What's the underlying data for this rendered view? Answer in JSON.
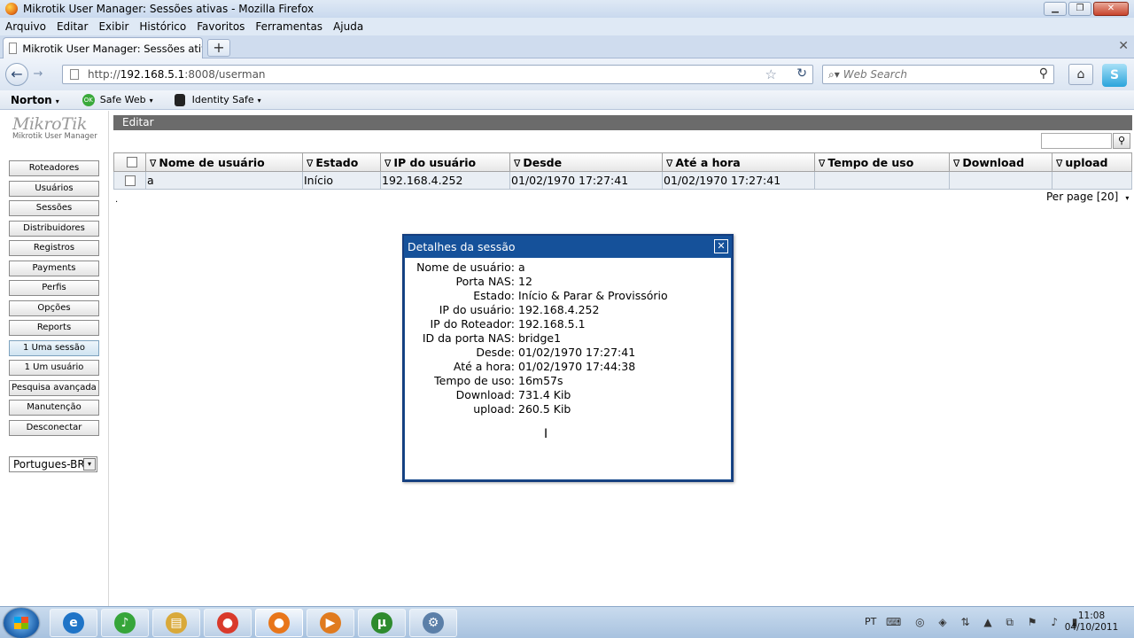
{
  "window": {
    "title": "Mikrotik User Manager: Sessões ativas - Mozilla Firefox",
    "minimize_glyph": "▁",
    "restore_glyph": "❐",
    "close_glyph": "✕"
  },
  "menu": [
    "Arquivo",
    "Editar",
    "Exibir",
    "Histórico",
    "Favoritos",
    "Ferramentas",
    "Ajuda"
  ],
  "tab": {
    "label": "Mikrotik User Manager: Sessões ativas",
    "new_tab_glyph": "+",
    "tab_list_glyph": "✕"
  },
  "nav": {
    "url_prefix": "http://",
    "url_host": "192.168.5.1",
    "url_rest": ":8008/userman",
    "search_placeholder": "Web Search",
    "back_glyph": "←",
    "forward_glyph": "→",
    "star_glyph": "☆",
    "reload_glyph": "↻",
    "search_engine_glyph": "⌕▾",
    "magnifier_glyph": "⚲",
    "home_glyph": "⌂",
    "skype_glyph": "S"
  },
  "norton": {
    "brand": "Norton",
    "safe_web": "Safe Web",
    "identity_safe": "Identity Safe",
    "ok_badge": "OK",
    "caret": "▾"
  },
  "sidebar": {
    "logo_main": "MikroTik",
    "logo_sub": "Mikrotik User Manager",
    "items": [
      {
        "label": "Roteadores"
      },
      {
        "label": "Usuários"
      },
      {
        "label": "Sessões"
      },
      {
        "label": "Distribuidores"
      },
      {
        "label": "Registros"
      },
      {
        "label": "Payments"
      },
      {
        "label": "Perfis"
      },
      {
        "label": "Opções"
      },
      {
        "label": "Reports"
      },
      {
        "label": "1 Uma sessão"
      },
      {
        "label": "1 Um usuário"
      },
      {
        "label": "Pesquisa avançada"
      },
      {
        "label": "Manutenção"
      },
      {
        "label": "Desconectar"
      }
    ],
    "language": "Portugues-BR",
    "dropdown_glyph": "▾"
  },
  "content": {
    "header": "Editar",
    "filter_button_glyph": "⚲",
    "sort_glyph": "∇",
    "columns": [
      "Nome de usuário",
      "Estado",
      "IP do usuário",
      "Desde",
      "Até a hora",
      "Tempo de uso",
      "Download",
      "upload"
    ],
    "rows": [
      [
        "a",
        "Início",
        "192.168.4.252",
        "01/02/1970 17:27:41",
        "01/02/1970 17:27:41",
        "",
        "",
        ""
      ]
    ],
    "dot": ".",
    "per_page": "Per page [20]",
    "per_page_arrow": "▾"
  },
  "modal": {
    "title": "Detalhes da sessão",
    "close_glyph": "✕",
    "cursor_glyph": "I",
    "fields": [
      {
        "label": "Nome de usuário:",
        "value": "a"
      },
      {
        "label": "Porta NAS:",
        "value": "12"
      },
      {
        "label": "Estado:",
        "value": "Início & Parar & Provissório"
      },
      {
        "label": "IP do usuário:",
        "value": "192.168.4.252"
      },
      {
        "label": "IP do Roteador:",
        "value": "192.168.5.1"
      },
      {
        "label": "ID da porta NAS:",
        "value": "bridge1"
      },
      {
        "label": "Desde:",
        "value": "01/02/1970 17:27:41"
      },
      {
        "label": "Até a hora:",
        "value": "01/02/1970 17:44:38"
      },
      {
        "label": "Tempo de uso:",
        "value": "16m57s"
      },
      {
        "label": "Download:",
        "value": "731.4 Kib"
      },
      {
        "label": "upload:",
        "value": "260.5 Kib"
      }
    ]
  },
  "taskbar": {
    "apps": [
      {
        "name": "internet-explorer",
        "glyph": "e",
        "color": "#1f74c7"
      },
      {
        "name": "media-player",
        "glyph": "♪",
        "color": "#36a53a"
      },
      {
        "name": "file-explorer",
        "glyph": "▤",
        "color": "#d9a93a"
      },
      {
        "name": "chrome",
        "glyph": "●",
        "color": "#d93a2b"
      },
      {
        "name": "firefox",
        "glyph": "●",
        "color": "#e8761a"
      },
      {
        "name": "media-app",
        "glyph": "▶",
        "color": "#e07b1f"
      },
      {
        "name": "utorrent",
        "glyph": "µ",
        "color": "#2e8b2e"
      },
      {
        "name": "network-app",
        "glyph": "⚙",
        "color": "#5b7fa8"
      }
    ],
    "language": "PT",
    "tray_glyphs": "⌨ ◎ ◈ ⇅ ▲ ⧉ ⚑ ♪ ▮",
    "time": "11:08",
    "date": "04/10/2011"
  }
}
